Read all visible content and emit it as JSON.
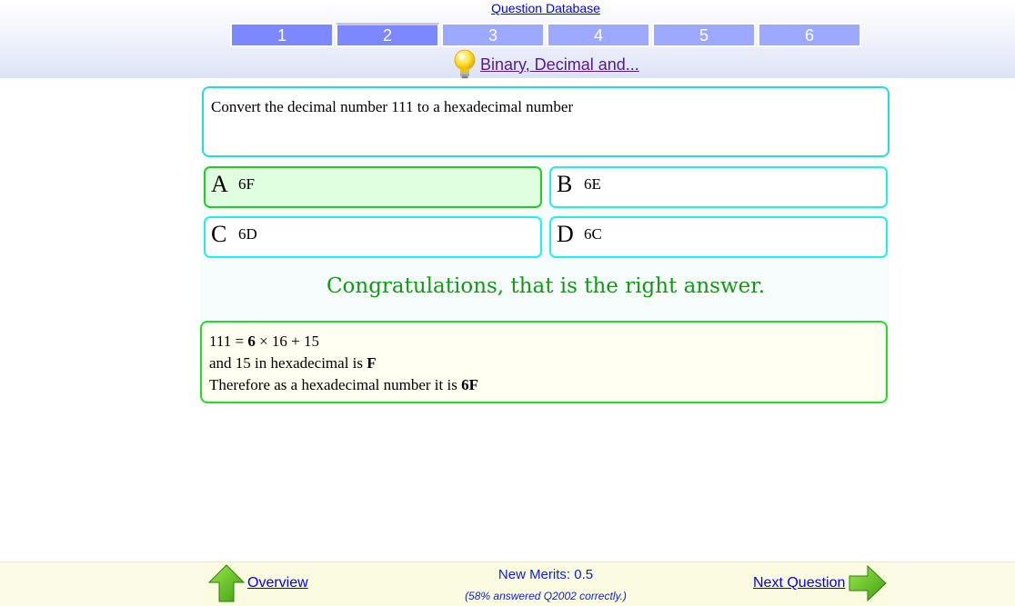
{
  "header": {
    "db_link": "Question Database",
    "tabs": [
      "1",
      "2",
      "3",
      "4",
      "5",
      "6"
    ],
    "current_tab": "2",
    "topic": "Binary, Decimal and..."
  },
  "question": {
    "text": "Convert the decimal number 111 to a hexadecimal number",
    "answers": [
      {
        "letter": "A",
        "value": "6F",
        "correct": true
      },
      {
        "letter": "B",
        "value": "6E"
      },
      {
        "letter": "C",
        "value": "6D"
      },
      {
        "letter": "D",
        "value": "6C"
      }
    ]
  },
  "feedback": {
    "message": "Congratulations, that is the right answer."
  },
  "explanation": {
    "line1": {
      "a": "111 = ",
      "b": "6",
      "c": " × 16 + 15"
    },
    "line2": {
      "a": "and 15 in hexadecimal is ",
      "b": "F"
    },
    "line3": {
      "a": "Therefore as a hexadecimal number it is ",
      "b": "6F"
    }
  },
  "footer": {
    "overview": "Overview",
    "merits": "New Merits: 0.5",
    "stats": "(58% answered Q2002 correctly.)",
    "next": "Next Question"
  },
  "colors": {
    "tab": "#9da9ff",
    "tab_done": "#7d88ff",
    "correct_border": "#22cc22",
    "answer_border": "#22eeee",
    "congrats": "#119911"
  },
  "icons": {
    "topic": "lightbulb-icon",
    "overview": "up-arrow-icon",
    "next": "right-arrow-icon"
  }
}
